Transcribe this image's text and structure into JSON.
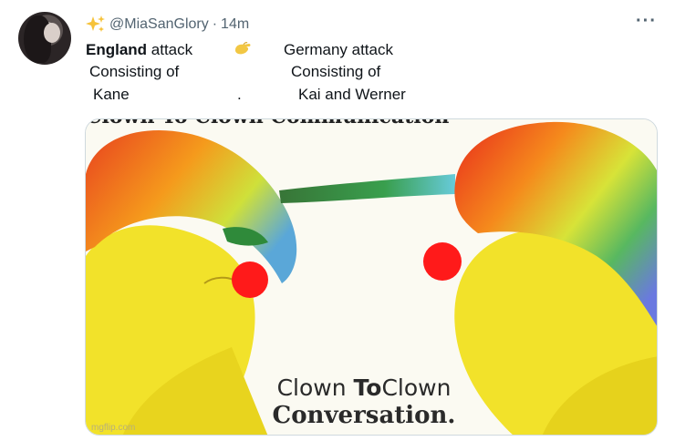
{
  "tweet": {
    "handle": "@MiaSanGlory",
    "separator": "·",
    "time": "14m",
    "more_label": "···",
    "left": {
      "team": "England",
      "line1_rest": " attack",
      "line2": "Consisting of",
      "line3": "Kane",
      "filler": "."
    },
    "right": {
      "line1": "Germany attack",
      "line2": "Consisting of",
      "line3": "Kai and Werner"
    }
  },
  "meme": {
    "top_text": "Clown To Clown Communication",
    "caption_line1_a": "Clown",
    "caption_line1_b": "To",
    "caption_line1_c": "Clown",
    "caption_line2": "Conversation.",
    "watermark": "mgflip.com"
  },
  "icons": {
    "status": "sparkles-icon",
    "emoji": "pinching-hand-icon",
    "more": "more-icon"
  },
  "colors": {
    "text": "#0f1419",
    "secondary": "#536471",
    "clown_nose": "#ff1a1a",
    "skin": "#f4e52a"
  }
}
